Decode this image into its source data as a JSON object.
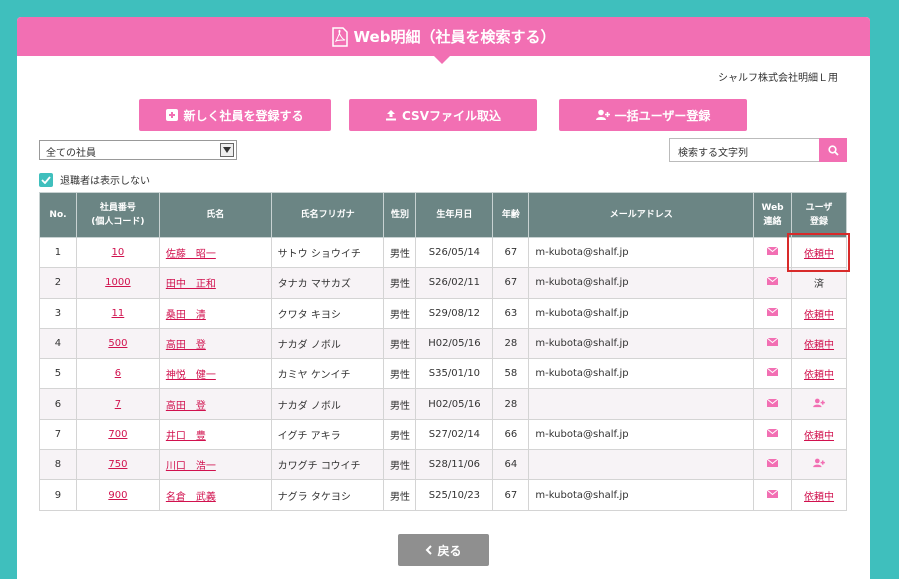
{
  "header": {
    "title": "Web明細（社員を検索する）"
  },
  "company": "シャルフ株式会社明細Ｌ用",
  "buttons": {
    "register": "新しく社員を登録する",
    "csv": "CSVファイル取込",
    "bulk": "一括ユーザー登録",
    "back": "戻る"
  },
  "filter": {
    "selected": "全ての社員"
  },
  "search": {
    "placeholder": "検索する文字列"
  },
  "hide_retired": "退職者は表示しない",
  "columns": {
    "no": "No.",
    "code_1": "社員番号",
    "code_2": "(個人コード)",
    "name": "氏名",
    "kana": "氏名フリガナ",
    "gender": "性別",
    "dob": "生年月日",
    "age": "年齢",
    "email": "メールアドレス",
    "web_1": "Web",
    "web_2": "連絡",
    "user_1": "ユーザ",
    "user_2": "登録"
  },
  "rows": [
    {
      "no": "1",
      "code": "10",
      "name": "佐藤　昭一",
      "kana": "サトウ ショウイチ",
      "gender": "男性",
      "dob": "S26/05/14",
      "age": "67",
      "email": "m-kubota@shalf.jp",
      "status": "依頼中",
      "status_type": "link"
    },
    {
      "no": "2",
      "code": "1000",
      "name": "田中　正和",
      "kana": "タナカ マサカズ",
      "gender": "男性",
      "dob": "S26/02/11",
      "age": "67",
      "email": "m-kubota@shalf.jp",
      "status": "済",
      "status_type": "text"
    },
    {
      "no": "3",
      "code": "11",
      "name": "桑田　清",
      "kana": "クワタ キヨシ",
      "gender": "男性",
      "dob": "S29/08/12",
      "age": "63",
      "email": "m-kubota@shalf.jp",
      "status": "依頼中",
      "status_type": "link"
    },
    {
      "no": "4",
      "code": "500",
      "name": "高田　登",
      "kana": "ナカダ ノボル",
      "gender": "男性",
      "dob": "H02/05/16",
      "age": "28",
      "email": "m-kubota@shalf.jp",
      "status": "依頼中",
      "status_type": "link"
    },
    {
      "no": "5",
      "code": "6",
      "name": "神悦　健一",
      "kana": "カミヤ ケンイチ",
      "gender": "男性",
      "dob": "S35/01/10",
      "age": "58",
      "email": "m-kubota@shalf.jp",
      "status": "依頼中",
      "status_type": "link"
    },
    {
      "no": "6",
      "code": "7",
      "name": "高田　登",
      "kana": "ナカダ ノボル",
      "gender": "男性",
      "dob": "H02/05/16",
      "age": "28",
      "email": "",
      "status": "",
      "status_type": "icon"
    },
    {
      "no": "7",
      "code": "700",
      "name": "井口　豊",
      "kana": "イグチ アキラ",
      "gender": "男性",
      "dob": "S27/02/14",
      "age": "66",
      "email": "m-kubota@shalf.jp",
      "status": "依頼中",
      "status_type": "link"
    },
    {
      "no": "8",
      "code": "750",
      "name": "川口　浩一",
      "kana": "カワグチ コウイチ",
      "gender": "男性",
      "dob": "S28/11/06",
      "age": "64",
      "email": "",
      "status": "",
      "status_type": "icon"
    },
    {
      "no": "9",
      "code": "900",
      "name": "名倉　武義",
      "kana": "ナグラ タケヨシ",
      "gender": "男性",
      "dob": "S25/10/23",
      "age": "67",
      "email": "m-kubota@shalf.jp",
      "status": "依頼中",
      "status_type": "link"
    }
  ],
  "colors": {
    "pink": "#f26fb3",
    "teal": "#3fbfbd",
    "header_gray": "#6b8584",
    "link_red": "#d1114e"
  }
}
